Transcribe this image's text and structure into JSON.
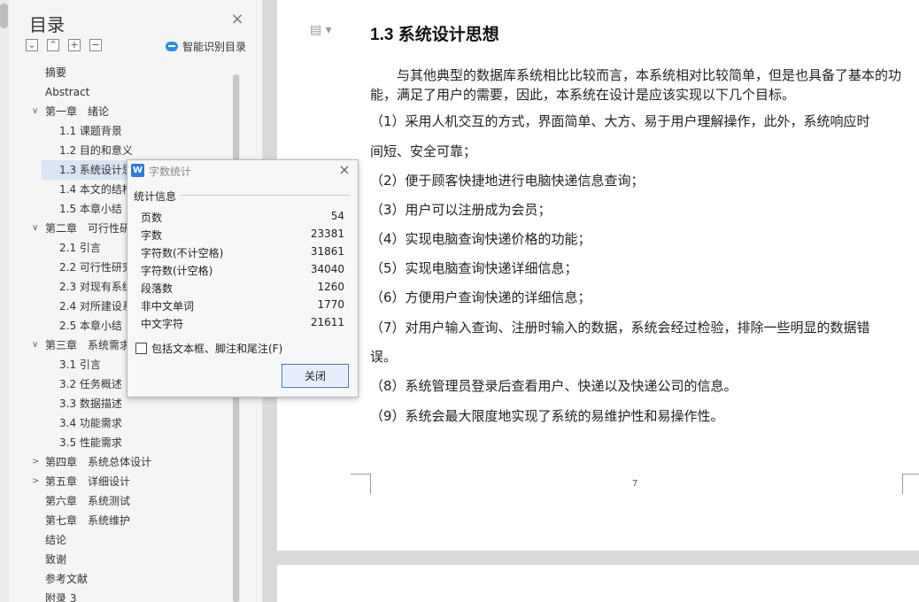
{
  "toc": {
    "title": "目录",
    "close_icon": "close-icon",
    "tools": [
      "collapse-icon",
      "expand-icon",
      "add-icon",
      "remove-icon"
    ],
    "smart_label": "智能识别目录",
    "items": [
      {
        "label": "摘要",
        "level": 0,
        "arrow": ""
      },
      {
        "label": "Abstract",
        "level": 0,
        "arrow": ""
      },
      {
        "label": "第一章　绪论",
        "level": 0,
        "arrow": "expanded"
      },
      {
        "label": "1.1 课题背景",
        "level": 1,
        "arrow": ""
      },
      {
        "label": "1.2 目的和意义",
        "level": 1,
        "arrow": ""
      },
      {
        "label": "1.3 系统设计思",
        "level": 1,
        "arrow": "",
        "active": true
      },
      {
        "label": "1.4 本文的结构",
        "level": 1,
        "arrow": ""
      },
      {
        "label": "1.5 本章小结",
        "level": 1,
        "arrow": ""
      },
      {
        "label": "第二章　可行性研究",
        "level": 0,
        "arrow": "expanded"
      },
      {
        "label": "2.1 引言",
        "level": 1,
        "arrow": ""
      },
      {
        "label": "2.2 可行性研究",
        "level": 1,
        "arrow": ""
      },
      {
        "label": "2.3 对现有系统",
        "level": 1,
        "arrow": ""
      },
      {
        "label": "2.4 对所建设系",
        "level": 1,
        "arrow": ""
      },
      {
        "label": "2.5 本章小结",
        "level": 1,
        "arrow": ""
      },
      {
        "label": "第三章　系统需求",
        "level": 0,
        "arrow": "expanded"
      },
      {
        "label": "3.1 引言",
        "level": 1,
        "arrow": ""
      },
      {
        "label": "3.2 任务概述",
        "level": 1,
        "arrow": ""
      },
      {
        "label": "3.3 数据描述",
        "level": 1,
        "arrow": ""
      },
      {
        "label": "3.4 功能需求",
        "level": 1,
        "arrow": ""
      },
      {
        "label": "3.5 性能需求",
        "level": 1,
        "arrow": ""
      },
      {
        "label": "第四章　系统总体设计",
        "level": 0,
        "arrow": "collapsed"
      },
      {
        "label": "第五章　详细设计",
        "level": 0,
        "arrow": "collapsed"
      },
      {
        "label": "第六章　系统测试",
        "level": 0,
        "arrow": ""
      },
      {
        "label": "第七章　系统维护",
        "level": 0,
        "arrow": ""
      },
      {
        "label": "结论",
        "level": 0,
        "arrow": ""
      },
      {
        "label": "致谢",
        "level": 0,
        "arrow": ""
      },
      {
        "label": "参考文献",
        "level": 0,
        "arrow": ""
      },
      {
        "label": "附录 3",
        "level": 0,
        "arrow": ""
      }
    ]
  },
  "document": {
    "heading": "1.3 系统设计思想",
    "intro": "与其他典型的数据库系统相比比较而言，本系统相对比较简单，但是也具备了基本的功能，满足了用户的需要，因此，本系统在设计是应该实现以下几个目标。",
    "goals": [
      "（1）采用人机交互的方式，界面简单、大方、易于用户理解操作，此外，系统响应时",
      "间短、安全可靠；",
      "（2）便于顾客快捷地进行电脑快递信息查询；",
      "（3）用户可以注册成为会员；",
      "（4）实现电脑查询快递价格的功能；",
      "（5）实现电脑查询快递详细信息；",
      "（6）方便用户查询快递的详细信息；",
      "（7）对用户输入查询、注册时输入的数据，系统会经过检验，排除一些明显的数据错",
      "误。",
      "（8）系统管理员登录后查看用户、快递以及快递公司的信息。",
      "（9）系统会最大限度地实现了系统的易维护性和易操作性。"
    ],
    "page_number": "7"
  },
  "dialog": {
    "title": "字数统计",
    "logo": "W",
    "group_label": "统计信息",
    "stats": [
      {
        "label": "页数",
        "value": "54"
      },
      {
        "label": "字数",
        "value": "23381"
      },
      {
        "label": "字符数(不计空格)",
        "value": "31861"
      },
      {
        "label": "字符数(计空格)",
        "value": "34040"
      },
      {
        "label": "段落数",
        "value": "1260"
      },
      {
        "label": "非中文单词",
        "value": "1770"
      },
      {
        "label": "中文字符",
        "value": "21611"
      }
    ],
    "checkbox_label": "包括文本框、脚注和尾注(F)",
    "close_button": "关闭"
  }
}
